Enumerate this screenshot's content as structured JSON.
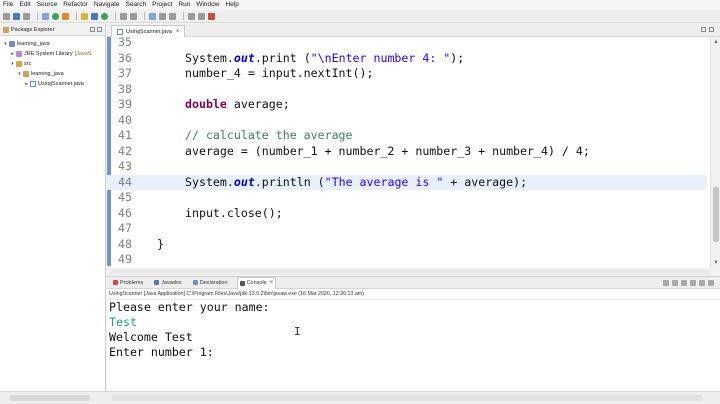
{
  "menu": [
    "File",
    "Edit",
    "Source",
    "Refactor",
    "Navigate",
    "Search",
    "Project",
    "Run",
    "Window",
    "Help"
  ],
  "explorer": {
    "title": "Package Explorer",
    "tree": [
      {
        "label": "learning_java",
        "indent": 0,
        "arrow": "▾",
        "icon": "project"
      },
      {
        "label": "JRE System Library",
        "suffix": "[JavaS",
        "indent": 1,
        "arrow": "▸",
        "icon": "lib"
      },
      {
        "label": "src",
        "indent": 1,
        "arrow": "▾",
        "icon": "folder"
      },
      {
        "label": "learning_java",
        "indent": 2,
        "arrow": "▾",
        "icon": "pkg"
      },
      {
        "label": "UsingScanner.java",
        "indent": 3,
        "arrow": "▸",
        "icon": "javafile"
      }
    ]
  },
  "editor": {
    "tab_label": "UsingScanner.java",
    "current_line": "44",
    "lines": [
      {
        "n": "35",
        "code": ""
      },
      {
        "n": "36",
        "code": "System.out.print (\"\\nEnter number 4: \");"
      },
      {
        "n": "37",
        "code": "number_4 = input.nextInt();"
      },
      {
        "n": "38",
        "code": ""
      },
      {
        "n": "39",
        "code": "double average;"
      },
      {
        "n": "40",
        "code": ""
      },
      {
        "n": "41",
        "code": "// calculate the average"
      },
      {
        "n": "42",
        "code": "average = (number_1 + number_2 + number_3 + number_4) / 4;"
      },
      {
        "n": "43",
        "code": ""
      },
      {
        "n": "44",
        "code": "System.out.println (\"The average is \" + average);"
      },
      {
        "n": "45",
        "code": ""
      },
      {
        "n": "46",
        "code": "input.close();"
      },
      {
        "n": "47",
        "code": ""
      },
      {
        "n": "48",
        "code": "}"
      },
      {
        "n": "49",
        "code": ""
      }
    ]
  },
  "console": {
    "tabs": [
      "Problems",
      "Javadoc",
      "Declaration",
      "Console"
    ],
    "active_tab": "Console",
    "process": "UsingScanner [Java Application] C:\\Program Files\\Java\\jdk-13.0.2\\bin\\javaw.exe (16 Mar 2020, 12:26:13 am)",
    "output": [
      {
        "text": "Please enter your name:",
        "kind": "out"
      },
      {
        "text": "Test",
        "kind": "input"
      },
      {
        "text": "Welcome Test",
        "kind": "out"
      },
      {
        "text": "Enter number 1:",
        "kind": "out"
      }
    ]
  },
  "colors": {
    "keyword": "#7f0055",
    "field": "#0000c0",
    "string": "#2a00ff",
    "comment": "#3f7f5f",
    "console_input": "#17a589",
    "current_line_bg": "#e8f0fb"
  }
}
